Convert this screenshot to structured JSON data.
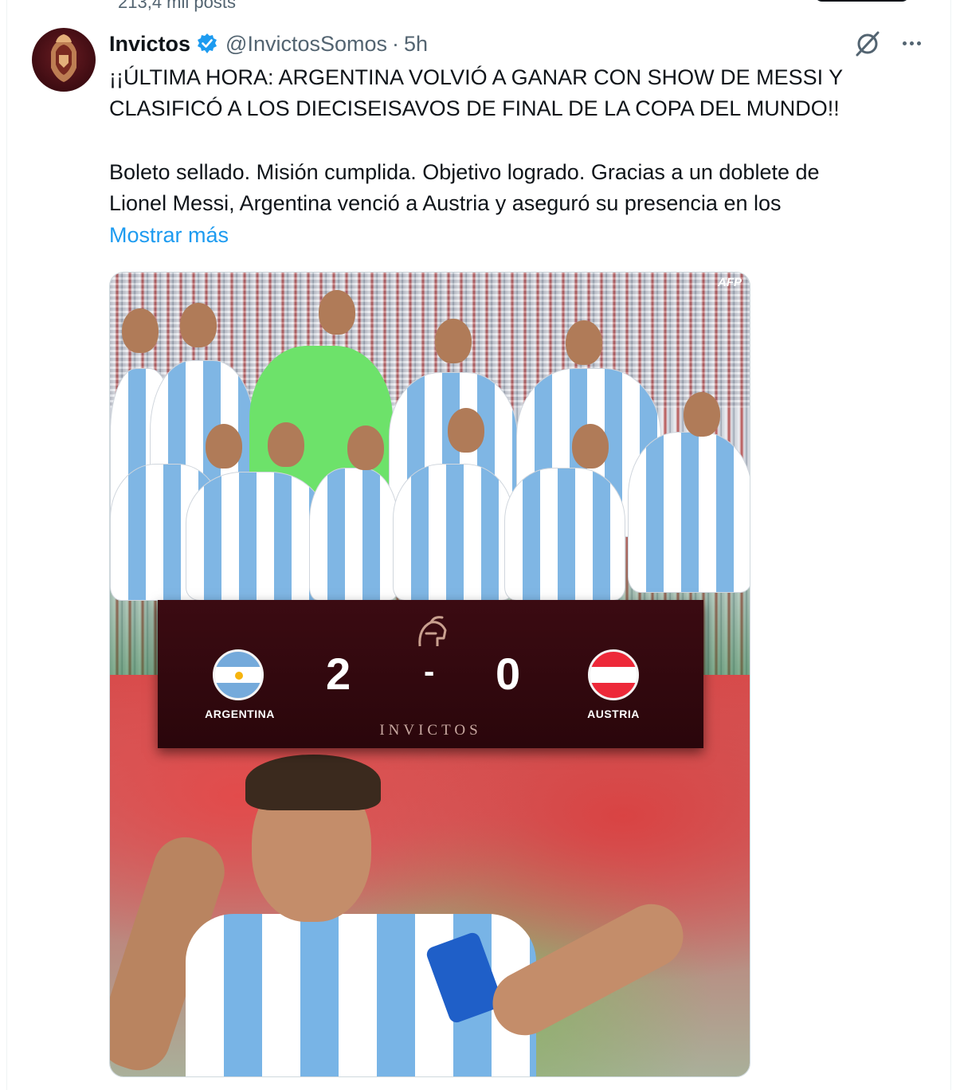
{
  "top_fragment": {
    "text": "213,4 mil posts"
  },
  "tweet": {
    "author_name": "Invictos",
    "handle": "@InvictosSomos",
    "separator": "·",
    "time": "5h",
    "headline_line1": "¡¡ÚLTIMA HORA: ARGENTINA VOLVIÓ A GANAR CON SHOW DE MESSI Y",
    "headline_line2": "CLASIFICÓ A LOS DIECISEISAVOS DE FINAL DE LA COPA DEL MUNDO!!",
    "body_line1": "Boleto sellado. Misión cumplida. Objetivo logrado. Gracias a un doblete de",
    "body_line2": "Lionel Messi, Argentina venció a Austria y aseguró su presencia en los",
    "show_more": "Mostrar más"
  },
  "media": {
    "photo_credit": "AFP",
    "scoreboard": {
      "home_team": "ARGENTINA",
      "away_team": "AUSTRIA",
      "home_score": "2",
      "dash": "-",
      "away_score": "0",
      "brand": "INVICTOS"
    }
  },
  "icons": {
    "verified": "verified-badge-icon",
    "grok": "grok-icon",
    "more": "more-options-icon"
  },
  "colors": {
    "link": "#1d9bf0",
    "secondary_text": "#536471",
    "scoreboard_bg": "#3b0b12"
  }
}
